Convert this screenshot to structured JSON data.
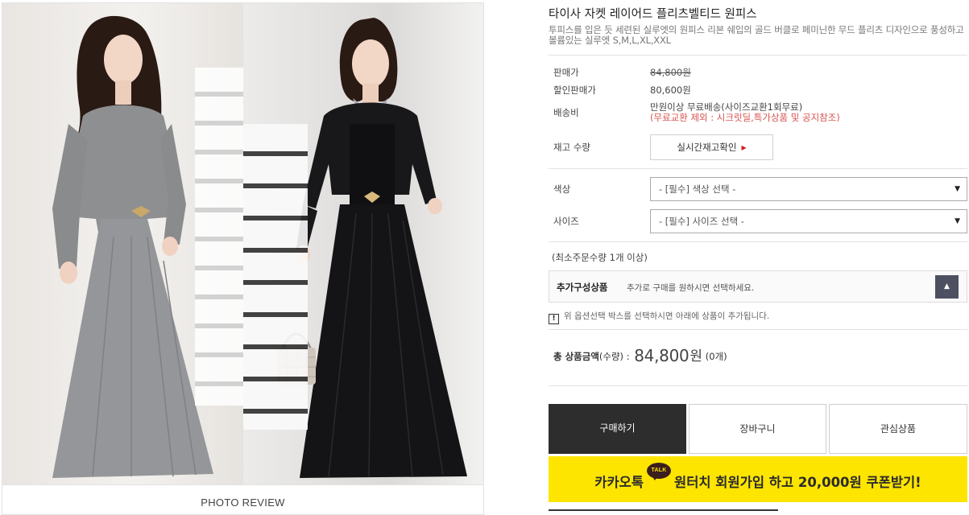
{
  "gallery": {
    "photo_review_label": "PHOTO REVIEW"
  },
  "product": {
    "title": "타이사 자켓 레이어드 플리츠벨티드 원피스",
    "description": "투피스를 입은 듯 세련된 실루엣의 원피스 리본 쉐입의 골드 버클로 페미닌한 무드 플리츠 디자인으로 풍성하고 볼륨있는 실루엣 S,M,L,XL,XXL"
  },
  "pricing": {
    "price_label": "판매가",
    "price_value": "84,800원",
    "sale_label": "할인판매가",
    "sale_value": "80,600원",
    "shipping_label": "배송비",
    "shipping_value": "만원이상 무료배송(사이즈교환1회무료)",
    "shipping_note": "(무료교환 제외 : 시크릿딜,특가상품 및 공지참조)"
  },
  "stock": {
    "label": "재고 수량",
    "button_label": "실시간재고확인",
    "arrow_icon": "triangle-right-icon",
    "arrow_color": "#d21c1c"
  },
  "options": {
    "color_label": "색상",
    "color_select": "- [필수] 색상 선택 -",
    "size_label": "사이즈",
    "size_select": "- [필수] 사이즈 선택 -",
    "caret_icon": "triangle-down-icon"
  },
  "order": {
    "min_order": "(최소주문수량 1개 이상)"
  },
  "addon": {
    "title": "추가구성상품",
    "description": "추가로 구매를 원하시면 선택하세요.",
    "toggle_icon": "triangle-up-icon"
  },
  "notice": {
    "icon": "exclamation-icon",
    "text": "위 옵션선택 박스를 선택하시면 아래에 상품이 추가됩니다."
  },
  "total": {
    "label": "총 상품금액",
    "qty_label": "(수량) : ",
    "amount": "84,800",
    "currency": "원",
    "count": "(0개)"
  },
  "actions": {
    "buy": "구매하기",
    "cart": "장바구니",
    "wishlist": "관심상품"
  },
  "kakao_banner": {
    "prefix": "카카오톡",
    "talk_icon_text": "TALK",
    "suffix": "원터치 회원가입 하고 20,000원 쿠폰받기!",
    "background": "#fee500"
  },
  "colors": {
    "buy_button_bg": "#2d2d2d",
    "note_red": "#d9534f",
    "addon_toggle_bg": "#4d5060"
  }
}
